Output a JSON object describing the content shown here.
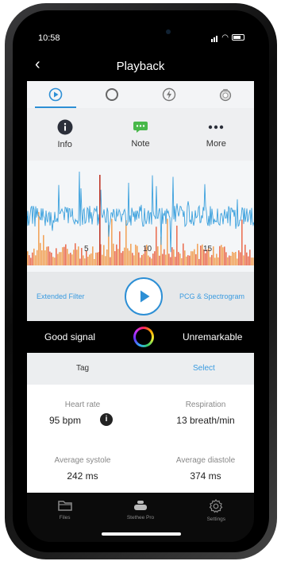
{
  "status": {
    "time": "10:58"
  },
  "nav": {
    "back_icon": "chevron-left-icon",
    "title": "Playback"
  },
  "tabs": [
    {
      "icon": "play-circle-icon",
      "active": true
    },
    {
      "icon": "circle-icon",
      "active": false
    },
    {
      "icon": "lightning-icon",
      "active": false
    },
    {
      "icon": "stethoscope-icon",
      "active": false
    }
  ],
  "actions": {
    "info": "Info",
    "note": "Note",
    "more": "More"
  },
  "chart_data": {
    "type": "area",
    "x_ticks": [
      "5",
      "10",
      "15"
    ],
    "series": [
      {
        "color": "#3aa0dd"
      },
      {
        "color": "#e8451f"
      }
    ]
  },
  "controls": {
    "left": "Extended Filter",
    "right": "PCG & Spectrogram"
  },
  "signal": {
    "left": "Good signal",
    "right": "Unremarkable"
  },
  "tagrow": {
    "tag": "Tag",
    "select": "Select"
  },
  "stats": {
    "heart_rate_label": "Heart rate",
    "heart_rate_value": "95 bpm",
    "respiration_label": "Respiration",
    "respiration_value": "13 breath/min",
    "systole_label": "Average systole",
    "systole_value": "242 ms",
    "diastole_label": "Average diastole",
    "diastole_value": "374 ms"
  },
  "tabbar": {
    "files": "Files",
    "stethee": "Stethee Pro",
    "settings": "Settings"
  },
  "colors": {
    "accent": "#2d8fd5",
    "info_green": "#48b84a"
  }
}
